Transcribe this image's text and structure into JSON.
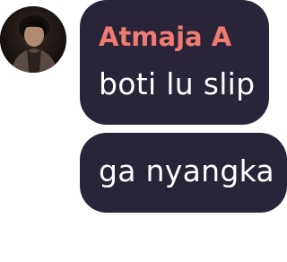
{
  "chat": {
    "sender": {
      "name": "Atmaja A",
      "name_color": "#ef7b72",
      "avatar_icon": "user-avatar"
    },
    "bubble_color": "#2a2438",
    "text_color": "#ffffff",
    "messages": [
      {
        "text": "boti lu slip"
      },
      {
        "text": "ga nyangka"
      }
    ]
  }
}
